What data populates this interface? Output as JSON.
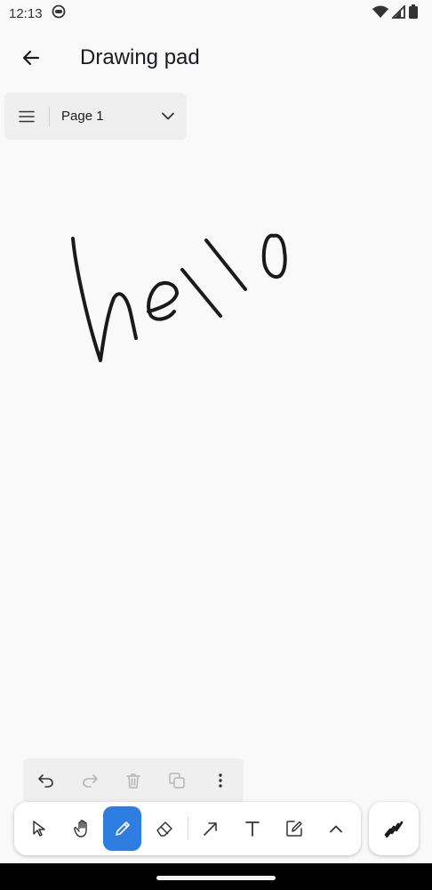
{
  "status_bar": {
    "time": "12:13"
  },
  "app_bar": {
    "title": "Drawing pad"
  },
  "page_selector": {
    "current_page": "Page 1"
  },
  "toolbar": {
    "active_tool": "pen",
    "accent_color": "#2f7de1",
    "tools": [
      "select",
      "hand",
      "pen",
      "eraser",
      "arrow",
      "text",
      "sticky-note",
      "expand"
    ]
  },
  "canvas": {
    "ink_color": "#1a1a1a"
  }
}
